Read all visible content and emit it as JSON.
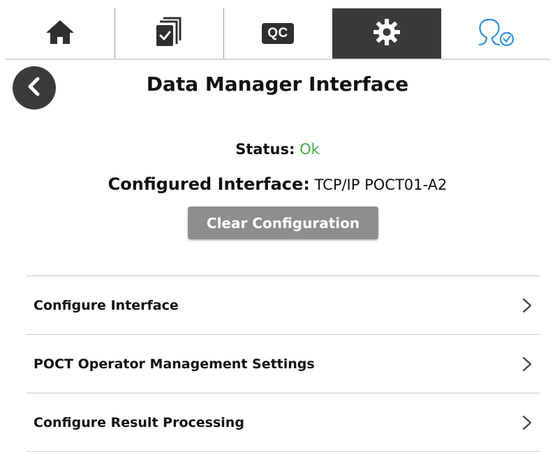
{
  "tabs": [
    {
      "name": "home",
      "icon": "home-icon"
    },
    {
      "name": "tasks",
      "icon": "checklist-icon"
    },
    {
      "name": "qc",
      "icon": "qc-icon",
      "label": "QC"
    },
    {
      "name": "settings",
      "icon": "gear-icon",
      "active": true
    },
    {
      "name": "user",
      "icon": "user-check-icon"
    }
  ],
  "header": {
    "back_icon": "chevron-left-icon",
    "title": "Data Manager Interface"
  },
  "status": {
    "label": "Status:",
    "value": "Ok",
    "value_color": "#3fae49"
  },
  "interface": {
    "label": "Configured Interface:",
    "value": "TCP/IP POCT01-A2"
  },
  "clear_button": {
    "label": "Clear Configuration",
    "color": "#8e8e8e"
  },
  "menu": {
    "items": [
      {
        "label": "Configure Interface"
      },
      {
        "label": "POCT Operator Management Settings"
      },
      {
        "label": "Configure Result Processing"
      }
    ]
  },
  "colors": {
    "active_tab": "#3a3a3a",
    "accent_blue": "#2b8fd6"
  }
}
